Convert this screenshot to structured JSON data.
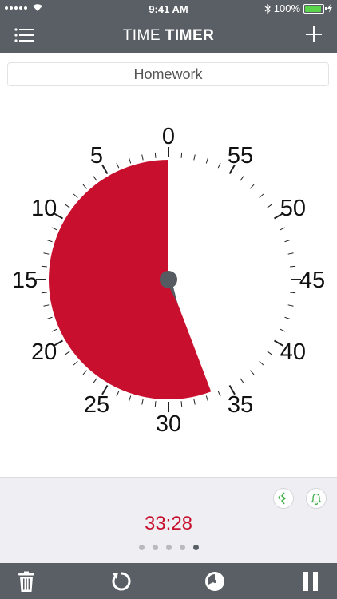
{
  "status_bar": {
    "time": "9:41 AM",
    "battery": "100%",
    "battery_level": 1.0
  },
  "header": {
    "title_light": "TIME",
    "title_bold": "TIMER",
    "menu_icon": "list-icon",
    "add_icon": "plus-icon"
  },
  "timer": {
    "name": "Homework",
    "dial_labels": [
      "0",
      "5",
      "10",
      "15",
      "20",
      "25",
      "30",
      "35",
      "40",
      "45",
      "50",
      "55"
    ],
    "remaining_minutes": 33.47,
    "display": "33:28",
    "disk_color": "#c8102e"
  },
  "controls": {
    "vibrate_icon": "vibrate-icon",
    "bell_icon": "bell-icon",
    "page_count": 5,
    "active_page": 5
  },
  "toolbar": {
    "items": [
      "trash-icon",
      "reset-icon",
      "settings-icon",
      "pause-icon"
    ]
  },
  "colors": {
    "bar": "#595f64",
    "accent_red": "#c8102e",
    "panel": "#eeeef3"
  }
}
